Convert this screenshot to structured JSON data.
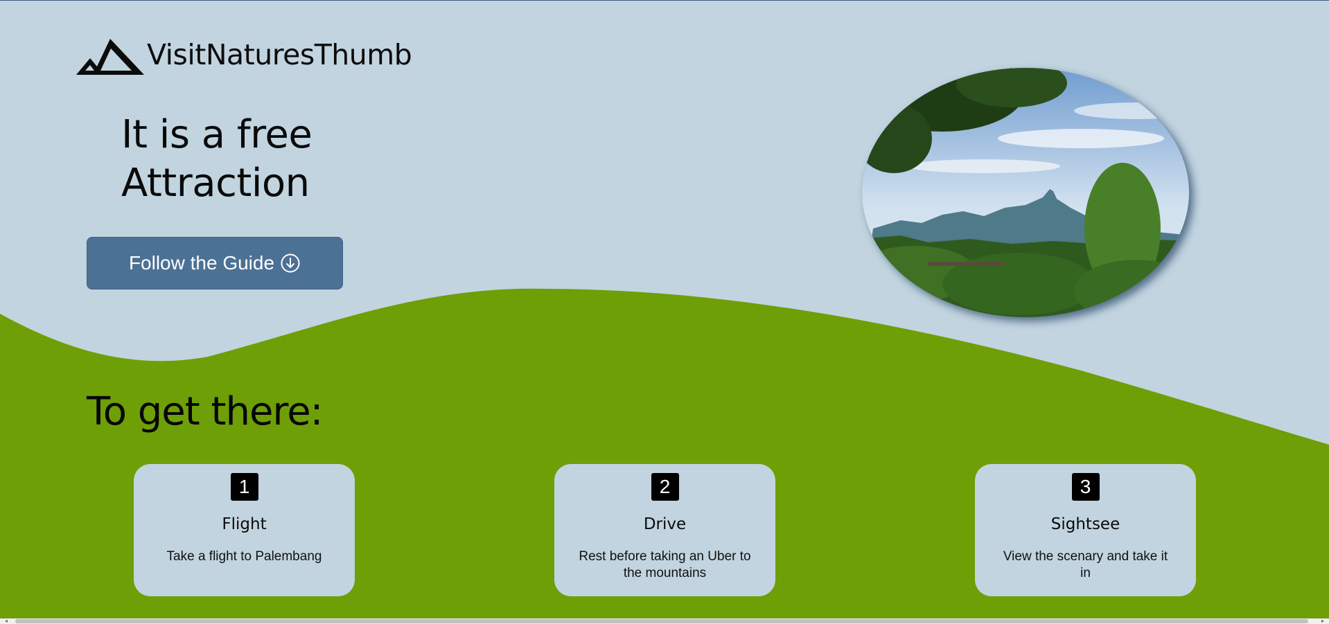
{
  "brand": {
    "name": "VisitNaturesThumb",
    "logo_icon": "mountain-logo-icon"
  },
  "hero": {
    "title_line1": "It is a free",
    "title_line2": "Attraction",
    "button_label": "Follow the Guide",
    "button_icon": "circle-arrow-down-icon",
    "image_subject": "mountain landscape photo"
  },
  "steps_section": {
    "title": "To get there:",
    "steps": [
      {
        "number": "1",
        "title": "Flight",
        "description": "Take a flight to Palembang"
      },
      {
        "number": "2",
        "title": "Drive",
        "description": "Rest before taking an Uber to the mountains"
      },
      {
        "number": "3",
        "title": "Sightsee",
        "description": "View the scenary and take it in"
      }
    ]
  },
  "colors": {
    "page_background": "#c2d4e0",
    "green_wave": "#6e9f06",
    "button_background": "#4b7195",
    "card_background": "#c2d4e0",
    "number_badge": "#000000"
  }
}
